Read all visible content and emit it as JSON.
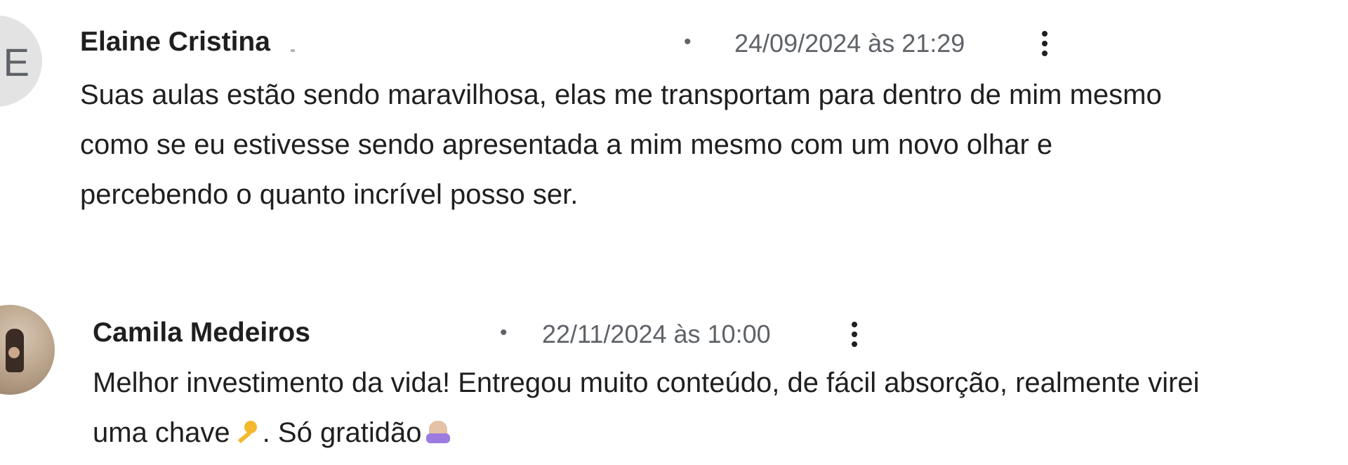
{
  "comments": [
    {
      "avatar_initial": "E",
      "author": "Elaine Cristina",
      "separator": "•",
      "timestamp": "24/09/2024 às 21:29",
      "text": "Suas aulas estão sendo maravilhosa, elas me transportam para dentro de mim mesmo\ncomo se eu estivesse sendo apresentada a mim mesmo com um novo olhar e\npercebendo o quanto incrível posso ser."
    },
    {
      "author": "Camila Medeiros",
      "separator": "•",
      "timestamp": "22/11/2024 às 10:00",
      "text_line1": "Melhor investimento da vida! Entregou muito conteúdo, de fácil absorção, realmente virei",
      "text_line2_a": "uma chave",
      "text_line2_b": ". Só gratidão",
      "emojis": [
        "key-icon",
        "folded-hands-icon"
      ]
    }
  ],
  "icons": {
    "more_options": "more-vert-icon"
  }
}
